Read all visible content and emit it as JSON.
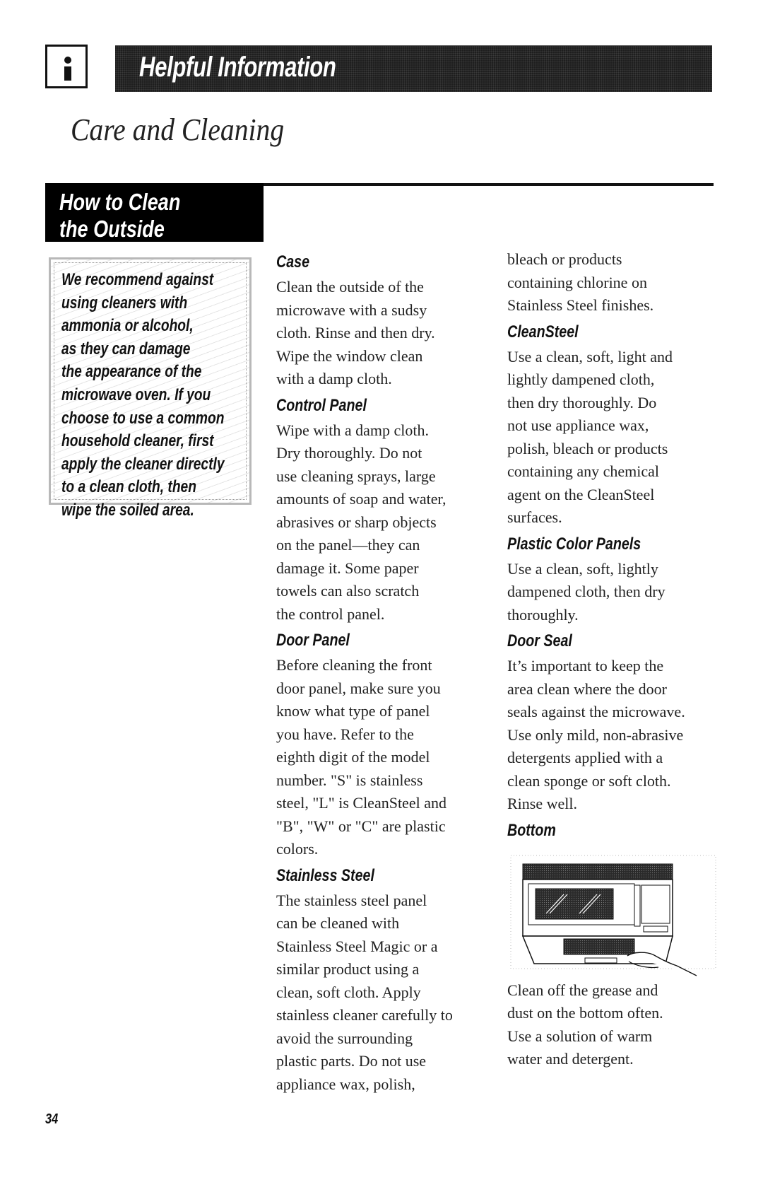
{
  "header": {
    "info_icon": "info-icon",
    "banner_title": "Helpful Information",
    "section_title": "Care and Cleaning"
  },
  "sidebar": {
    "block_title_lines": [
      "How to Clean",
      "the Outside"
    ],
    "note_lines": [
      "We recommend against",
      "using cleaners with",
      "ammonia or alcohol,",
      "as they can damage",
      "the appearance of the",
      "microwave oven. If you",
      "choose to use a common",
      "household cleaner, first",
      "apply the cleaner directly",
      "to a clean cloth, then",
      "wipe the soiled area."
    ]
  },
  "middle_column": {
    "sections": [
      {
        "heading": "Case",
        "lines": [
          "Clean the outside of the",
          "microwave with a sudsy",
          "cloth. Rinse and then dry.",
          "Wipe the window clean",
          "with a damp cloth."
        ]
      },
      {
        "heading": "Control Panel",
        "lines": [
          "Wipe with a damp cloth.",
          "Dry thoroughly. Do not",
          "use cleaning sprays, large",
          "amounts of soap and water,",
          "abrasives or sharp objects",
          "on the panel—they can",
          "damage it. Some paper",
          "towels can also scratch",
          "the control panel."
        ]
      },
      {
        "heading": "Door Panel",
        "lines": [
          "Before cleaning the front",
          "door panel, make sure you",
          "know what type of panel",
          "you have. Refer to the",
          "eighth digit of the model",
          "number. \"S\" is stainless",
          "steel, \"L\" is CleanSteel and",
          "\"B\", \"W\" or \"C\" are plastic",
          "colors."
        ]
      },
      {
        "heading": "Stainless Steel",
        "lines": [
          "The stainless steel panel",
          "can be cleaned with",
          "Stainless Steel Magic or a",
          "similar product using a",
          "clean, soft cloth. Apply",
          "stainless cleaner carefully to",
          "avoid the surrounding",
          "plastic parts. Do not use",
          "appliance wax, polish,"
        ]
      }
    ]
  },
  "right_column": {
    "continued_lines": [
      "bleach or products",
      "containing chlorine on",
      "Stainless Steel finishes."
    ],
    "sections": [
      {
        "heading": "CleanSteel",
        "lines": [
          "Use a clean, soft, light and",
          "lightly dampened cloth,",
          "then dry thoroughly. Do",
          "not use appliance wax,",
          "polish, bleach or products",
          "containing any chemical",
          "agent on the CleanSteel",
          "surfaces."
        ]
      },
      {
        "heading": "Plastic Color Panels",
        "lines": [
          "Use a clean, soft, lightly",
          "dampened cloth, then dry",
          "thoroughly."
        ]
      },
      {
        "heading": "Door Seal",
        "lines": [
          "It’s important to keep the",
          "area clean where the door",
          "seals against the microwave.",
          "Use only mild, non-abrasive",
          "detergents applied with a",
          "clean sponge or soft cloth.",
          "Rinse well."
        ]
      },
      {
        "heading": "Bottom",
        "illustration": "microwave-bottom-cleaning-illustration",
        "lines": [
          "Clean off the grease and",
          "dust on the bottom often.",
          "Use a solution of warm",
          "water and detergent."
        ]
      }
    ]
  },
  "footer": {
    "page_number": "34"
  }
}
